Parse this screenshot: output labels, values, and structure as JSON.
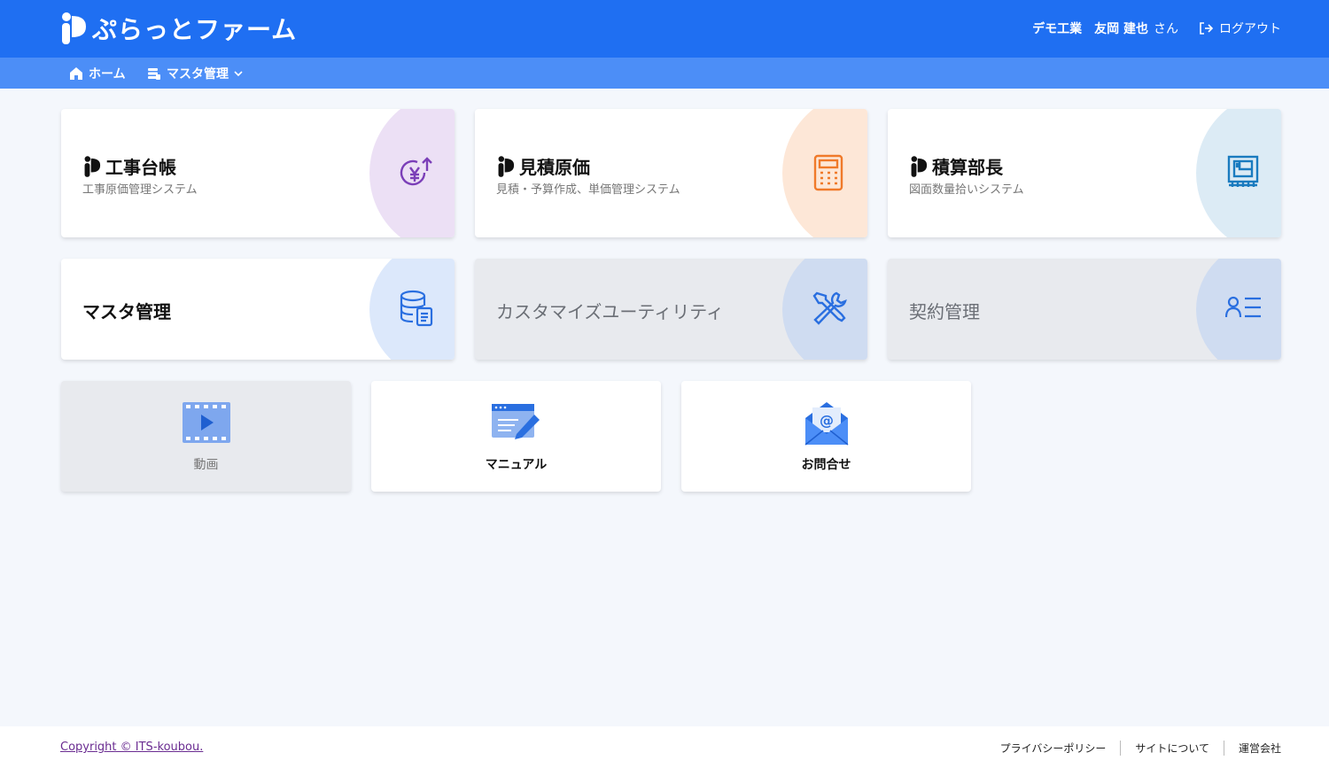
{
  "header": {
    "app_name": "ぷらっとファーム",
    "company": "デモ工業",
    "user_name": "友岡 建也",
    "user_suffix": "さん",
    "logout_label": "ログアウト"
  },
  "nav": {
    "home_label": "ホーム",
    "master_label": "マスタ管理"
  },
  "cards": {
    "koji": {
      "title": "工事台帳",
      "subtitle": "工事原価管理システム",
      "icon": "yen-up-icon",
      "circle_color": "#ece0f5",
      "icon_color": "#7b3fb8"
    },
    "mitsumori": {
      "title": "見積原価",
      "subtitle": "見積・予算作成、単価管理システム",
      "icon": "calculator-icon",
      "circle_color": "#fde7d7",
      "icon_color": "#f07a2a"
    },
    "sekisan": {
      "title": "積算部長",
      "subtitle": "図面数量拾いシステム",
      "icon": "blueprint-icon",
      "circle_color": "#dcebf5",
      "icon_color": "#1a7bbf"
    },
    "master": {
      "title": "マスタ管理",
      "icon": "database-icon",
      "circle_color": "#dce8fb",
      "icon_color": "#2a6fe0"
    },
    "custom": {
      "title": "カスタマイズユーティリティ",
      "icon": "tools-icon",
      "circle_color": "#cfdcf1",
      "icon_color": "#2a6fe0"
    },
    "keiyaku": {
      "title": "契約管理",
      "icon": "user-list-icon",
      "circle_color": "#cfdcf1",
      "icon_color": "#2a6fe0"
    }
  },
  "tiles": {
    "video": {
      "label": "動画",
      "icon": "video-icon"
    },
    "manual": {
      "label": "マニュアル",
      "icon": "manual-icon"
    },
    "contact": {
      "label": "お問合せ",
      "icon": "mail-icon"
    }
  },
  "footer": {
    "copyright": "Copyright © ITS-koubou.",
    "links": [
      "プライバシーポリシー",
      "サイトについて",
      "運営会社"
    ]
  }
}
